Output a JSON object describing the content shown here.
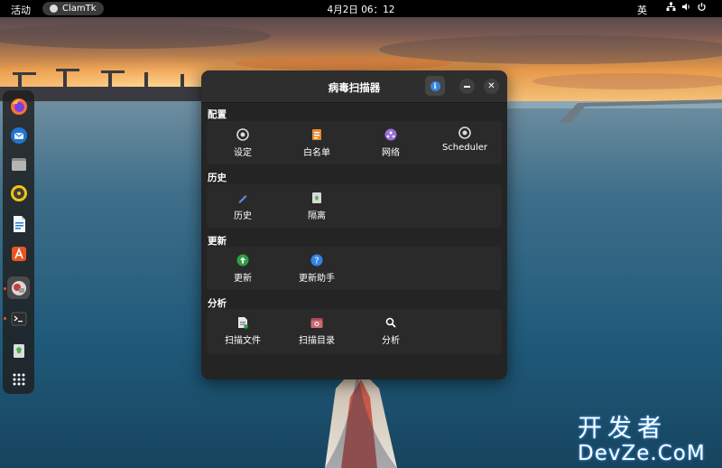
{
  "topbar": {
    "activities": "活动",
    "app_name": "ClamTk",
    "clock": "4月2日  06：12",
    "ime": "英",
    "tray_icons": [
      "network-icon",
      "volume-icon",
      "power-icon"
    ]
  },
  "dock": {
    "apps": [
      "firefox-icon",
      "thunderbird-icon",
      "files-icon",
      "rhythmbox-icon",
      "writer-icon",
      "app-center-icon",
      "clamtk-icon",
      "terminal-icon",
      "trash-icon",
      "app-grid-icon"
    ],
    "running": [
      "clamtk-icon",
      "terminal-icon"
    ]
  },
  "window": {
    "title": "病毒扫描器",
    "sections": [
      {
        "label": "配置",
        "tools": [
          {
            "label": "设定",
            "icon": "settings-gear-icon"
          },
          {
            "label": "白名单",
            "icon": "whitelist-icon"
          },
          {
            "label": "网络",
            "icon": "network-globe-icon"
          },
          {
            "label": "Scheduler",
            "icon": "scheduler-gear-icon"
          }
        ]
      },
      {
        "label": "历史",
        "tools": [
          {
            "label": "历史",
            "icon": "history-pencil-icon"
          },
          {
            "label": "隔离",
            "icon": "quarantine-icon"
          }
        ]
      },
      {
        "label": "更新",
        "tools": [
          {
            "label": "更新",
            "icon": "update-arrow-icon"
          },
          {
            "label": "更新助手",
            "icon": "update-help-icon"
          }
        ]
      },
      {
        "label": "分析",
        "tools": [
          {
            "label": "扫描文件",
            "icon": "scan-file-icon"
          },
          {
            "label": "扫描目录",
            "icon": "scan-folder-icon"
          },
          {
            "label": "分析",
            "icon": "analysis-search-icon"
          }
        ]
      }
    ]
  },
  "watermark": {
    "top": "开发者",
    "bottom": "DevZe.CoM"
  },
  "colors": {
    "window_bg": "#242424",
    "titlebar_bg": "#2e2e2e",
    "accent_blue": "#3584e4",
    "ubuntu_orange": "#e95420"
  }
}
